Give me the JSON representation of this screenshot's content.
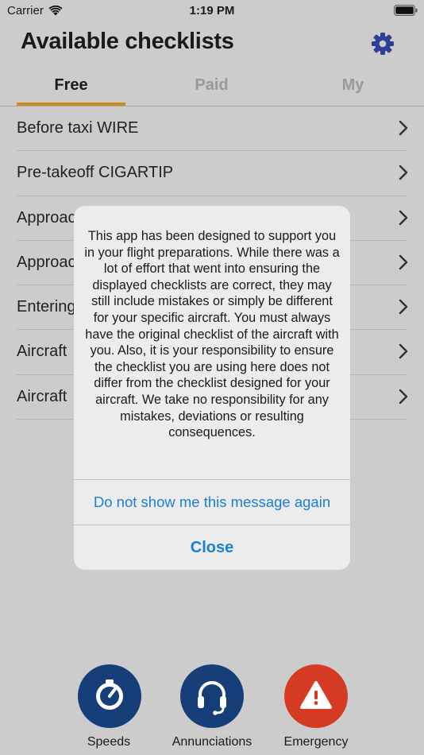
{
  "status": {
    "carrier": "Carrier",
    "time": "1:19 PM"
  },
  "header": {
    "title": "Available checklists"
  },
  "tabs": [
    {
      "label": "Free",
      "active": true
    },
    {
      "label": "Paid",
      "active": false
    },
    {
      "label": "My",
      "active": false
    }
  ],
  "list": [
    {
      "label": "Before taxi WIRE"
    },
    {
      "label": "Pre-takeoff CIGARTIP"
    },
    {
      "label": "Approac"
    },
    {
      "label": "Approac"
    },
    {
      "label": "Entering"
    },
    {
      "label": "Aircraft"
    },
    {
      "label": "Aircraft"
    }
  ],
  "alert": {
    "message": "This app has been designed to support you in your flight preparations. While there was a lot of effort that went into ensuring the displayed checklists are correct, they may still include mistakes or simply be different for your specific aircraft. You must always have the original checklist of the aircraft with you. Also, it is your responsibility to ensure the checklist you are using here does not differ from the checklist designed for your aircraft. We take no responsibility for any mistakes, deviations or resulting consequences.",
    "dont_show_label": "Do not show me this message again",
    "close_label": "Close"
  },
  "bottom": {
    "speeds_label": "Speeds",
    "annunciations_label": "Annunciations",
    "emergency_label": "Emergency"
  },
  "colors": {
    "accent": "#c98e1a",
    "navy": "#163e78",
    "emergency": "#d63a22",
    "link": "#1b7fd6"
  }
}
